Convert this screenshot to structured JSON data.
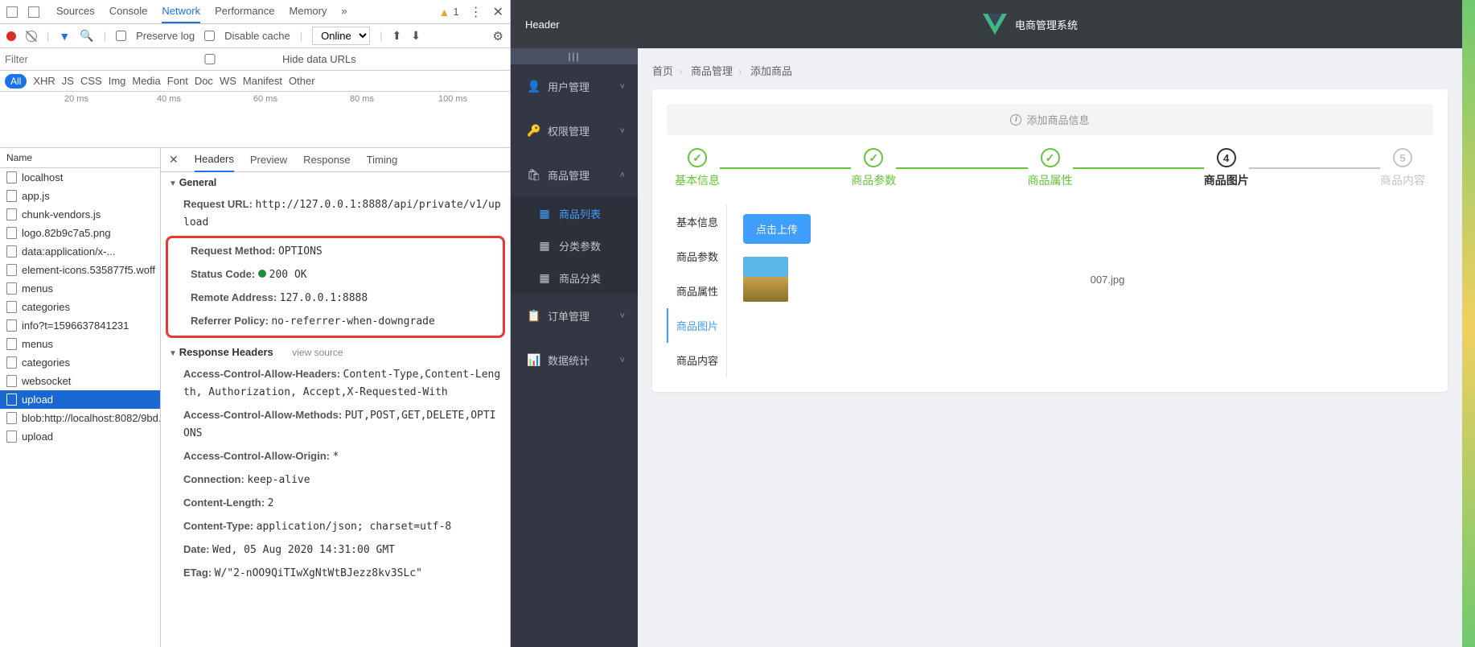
{
  "devtools": {
    "tabs": [
      "Sources",
      "Console",
      "Network",
      "Performance",
      "Memory"
    ],
    "active_tab": "Network",
    "warning_count": "1",
    "preserve_log": "Preserve log",
    "disable_cache": "Disable cache",
    "throttle": "Online",
    "filter_placeholder": "Filter",
    "hide_data_urls": "Hide data URLs",
    "filter_types": [
      "All",
      "XHR",
      "JS",
      "CSS",
      "Img",
      "Media",
      "Font",
      "Doc",
      "WS",
      "Manifest",
      "Other"
    ],
    "timeline_ticks": [
      "20 ms",
      "40 ms",
      "60 ms",
      "80 ms",
      "100 ms"
    ],
    "name_header": "Name",
    "requests": [
      "localhost",
      "app.js",
      "chunk-vendors.js",
      "logo.82b9c7a5.png",
      "data:application/x-...",
      "element-icons.535877f5.woff",
      "menus",
      "categories",
      "info?t=1596637841231",
      "menus",
      "categories",
      "websocket",
      "upload",
      "blob:http://localhost:8082/9bd...",
      "upload"
    ],
    "selected_request_index": 12,
    "detail_tabs": [
      "Headers",
      "Preview",
      "Response",
      "Timing"
    ],
    "active_detail_tab": "Headers",
    "general_label": "General",
    "general": {
      "request_url_k": "Request URL:",
      "request_url_v": "http://127.0.0.1:8888/api/private/v1/upload",
      "method_k": "Request Method:",
      "method_v": "OPTIONS",
      "status_k": "Status Code:",
      "status_v": "200 OK",
      "remote_k": "Remote Address:",
      "remote_v": "127.0.0.1:8888",
      "referrer_k": "Referrer Policy:",
      "referrer_v": "no-referrer-when-downgrade"
    },
    "response_headers_label": "Response Headers",
    "view_source": "view source",
    "response_headers": [
      {
        "k": "Access-Control-Allow-Headers:",
        "v": "Content-Type,Content-Length, Authorization, Accept,X-Requested-With"
      },
      {
        "k": "Access-Control-Allow-Methods:",
        "v": "PUT,POST,GET,DELETE,OPTIONS"
      },
      {
        "k": "Access-Control-Allow-Origin:",
        "v": "*"
      },
      {
        "k": "Connection:",
        "v": "keep-alive"
      },
      {
        "k": "Content-Length:",
        "v": "2"
      },
      {
        "k": "Content-Type:",
        "v": "application/json; charset=utf-8"
      },
      {
        "k": "Date:",
        "v": "Wed, 05 Aug 2020 14:31:00 GMT"
      },
      {
        "k": "ETag:",
        "v": "W/\"2-nOO9QiTIwXgNtWtBJezz8kv3SLc\""
      }
    ]
  },
  "app": {
    "header_text": "Header",
    "title": "电商管理系统",
    "collapse": "|||",
    "menu": [
      {
        "icon": "👤",
        "label": "用户管理",
        "sub": []
      },
      {
        "icon": "🔑",
        "label": "权限管理",
        "sub": []
      },
      {
        "icon": "🛍",
        "label": "商品管理",
        "sub": [
          {
            "label": "商品列表",
            "active": true
          },
          {
            "label": "分类参数"
          },
          {
            "label": "商品分类"
          }
        ]
      },
      {
        "icon": "📋",
        "label": "订单管理",
        "sub": []
      },
      {
        "icon": "📊",
        "label": "数据统计",
        "sub": []
      }
    ],
    "breadcrumb": [
      "首页",
      "商品管理",
      "添加商品"
    ],
    "alert": "添加商品信息",
    "steps": [
      "基本信息",
      "商品参数",
      "商品属性",
      "商品图片",
      "商品内容"
    ],
    "current_step_index": 3,
    "form_tabs": [
      "基本信息",
      "商品参数",
      "商品属性",
      "商品图片",
      "商品内容"
    ],
    "active_form_tab_index": 3,
    "upload_btn": "点击上传",
    "uploaded_file": "007.jpg"
  }
}
